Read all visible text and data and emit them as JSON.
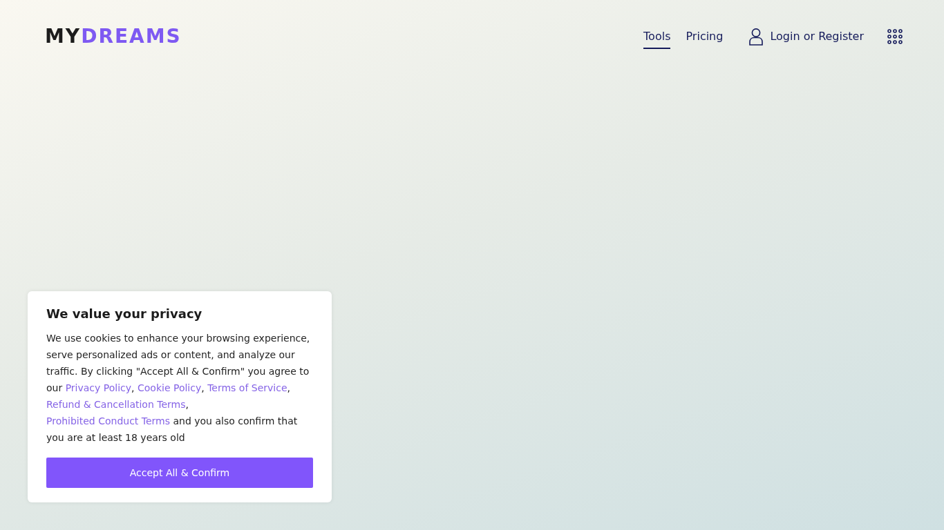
{
  "header": {
    "logo": {
      "dark": "MY",
      "accent": "DREAMS"
    },
    "nav": [
      {
        "label": "Tools",
        "selected": true
      },
      {
        "label": "Pricing",
        "selected": false
      }
    ],
    "account_link": "Login or Register"
  },
  "cookie_banner": {
    "title": "We value your privacy",
    "body": [
      {
        "kind": "text",
        "text": "We use cookies to enhance your browsing experience, serve personalized ads or content, and analyze our traffic. By clicking \"Accept All & Confirm\" you agree to our "
      },
      {
        "kind": "link",
        "text": "Privacy Policy"
      },
      {
        "kind": "text",
        "text": ", "
      },
      {
        "kind": "link",
        "text": "Cookie Policy"
      },
      {
        "kind": "text",
        "text": ", "
      },
      {
        "kind": "link",
        "text": "Terms of Service"
      },
      {
        "kind": "text",
        "text": ", "
      },
      {
        "kind": "link",
        "text": "Refund & Cancellation Terms"
      },
      {
        "kind": "text",
        "text": ", "
      },
      {
        "kind": "link",
        "text": "Prohibited Conduct Terms"
      },
      {
        "kind": "text",
        "text": " and you also confirm that you are at least 18 years old"
      }
    ],
    "button": "Accept All & Confirm"
  }
}
